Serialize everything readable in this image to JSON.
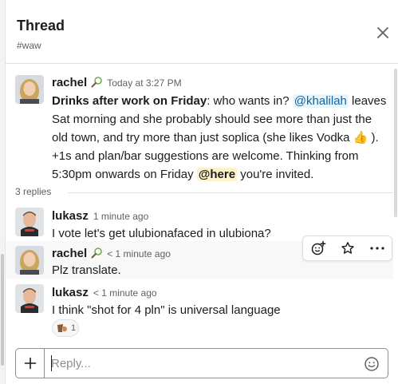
{
  "header": {
    "title": "Thread",
    "channel": "#waw"
  },
  "icons": {
    "close": "close-icon",
    "status": "tennis-racket-icon",
    "add_reaction": "add-reaction-icon",
    "star": "star-icon",
    "more": "more-actions-icon",
    "plus": "plus-icon",
    "emoji": "emoji-icon"
  },
  "parent": {
    "author": "rachel",
    "time": "Today at 3:27 PM",
    "bold_text": "Drinks after work on Friday",
    "text_1": ": who wants in?",
    "mention": "@khalilah",
    "text_2": " leaves Sat morning and she probably should see more than just the old town, and try more than just soplica (she likes Vodka ",
    "emoji": "👍",
    "text_3": " ). +1s and plan/bar suggestions are welcome. Thinking from 5:30pm onwards on Friday ",
    "here": "@here",
    "text_4": " you're invited."
  },
  "replies_label": "3 replies",
  "replies": [
    {
      "author": "lukasz",
      "time": "1 minute ago",
      "text": "I vote let's get ulubionafaced in ulubiona?"
    },
    {
      "author": "rachel",
      "time": "< 1 minute ago",
      "text": "Plz translate."
    },
    {
      "author": "lukasz",
      "time": "< 1 minute ago",
      "text": "I think \"shot for 4 pln\" is universal language"
    }
  ],
  "reaction": {
    "icon": "shot-glass-custom-emoji",
    "count": "1"
  },
  "composer": {
    "placeholder": "Reply..."
  },
  "colors": {
    "link": "#1264a3",
    "mention_bg": "#e8f5fa",
    "here_bg": "#fdf2c8",
    "hover_bg": "#f8f8f8"
  }
}
